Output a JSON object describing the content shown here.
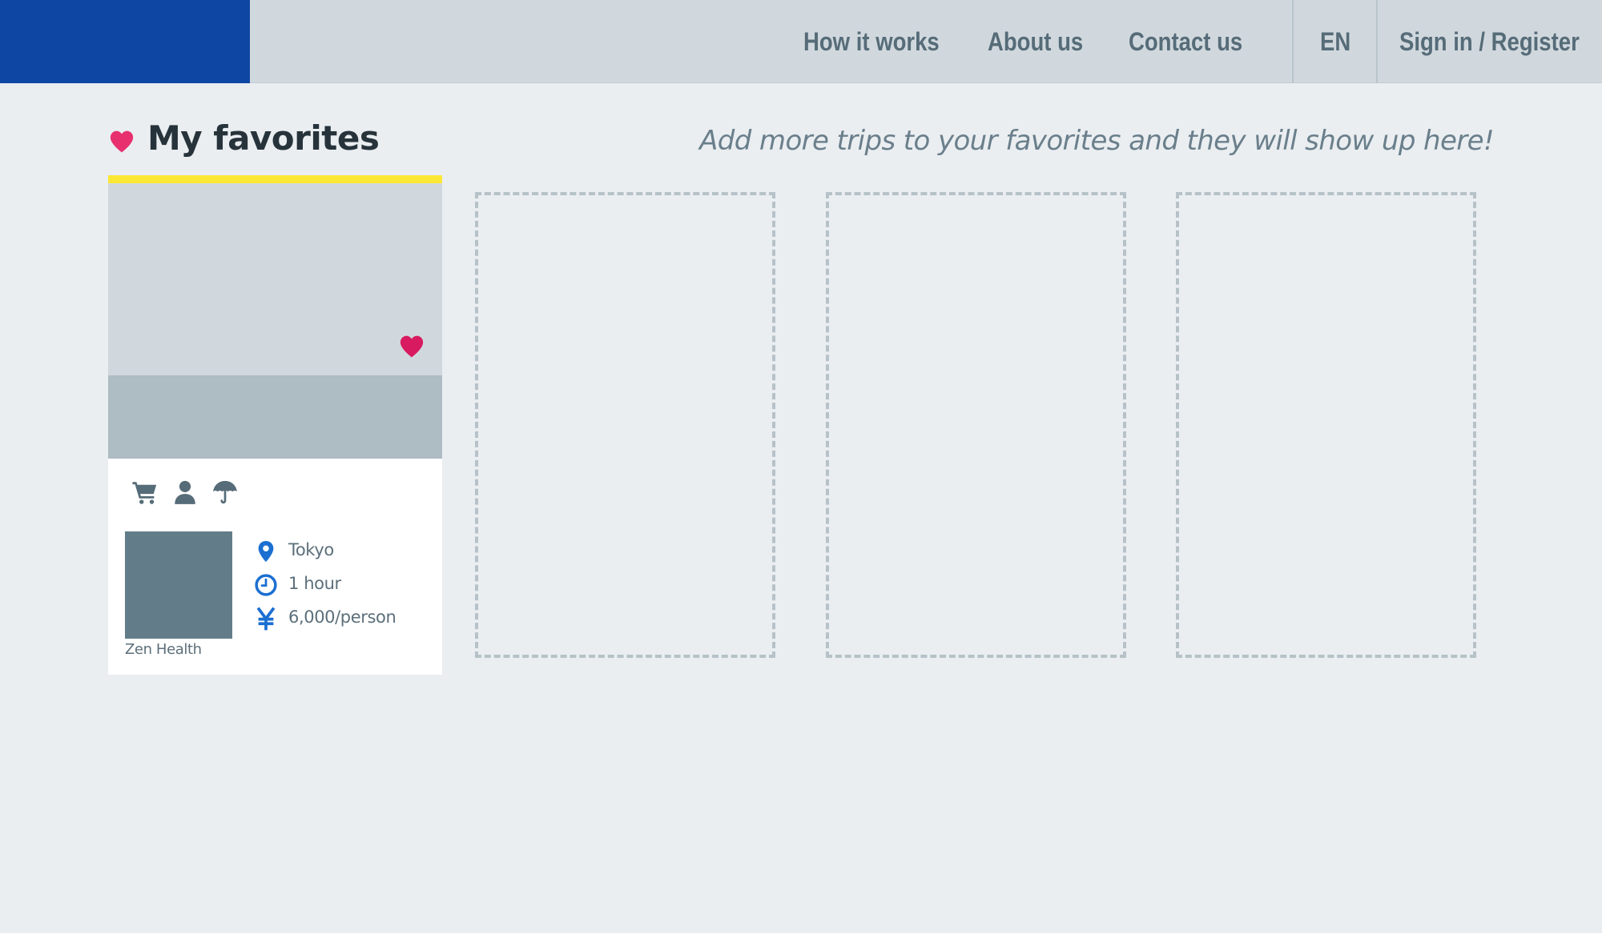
{
  "nav": {
    "links": [
      "How it works",
      "About us",
      "Contact us"
    ],
    "language": "EN",
    "auth": "Sign in / Register"
  },
  "favorites": {
    "title": "My favorites",
    "hint": "Add more trips to your favorites and they will show up here!"
  },
  "card": {
    "accent_color": "#fde735",
    "category_icons": [
      "cart-icon",
      "person-icon",
      "umbrella-icon"
    ],
    "provider": "Zen Health",
    "location": "Tokyo",
    "duration": "1 hour",
    "price": "6,000/person",
    "favorited": true
  },
  "empty_slots": 3,
  "colors": {
    "brand": "#0e46a3",
    "heart": "#e8306e",
    "info_icon": "#1b6fd1",
    "nav_text": "#566c78"
  }
}
